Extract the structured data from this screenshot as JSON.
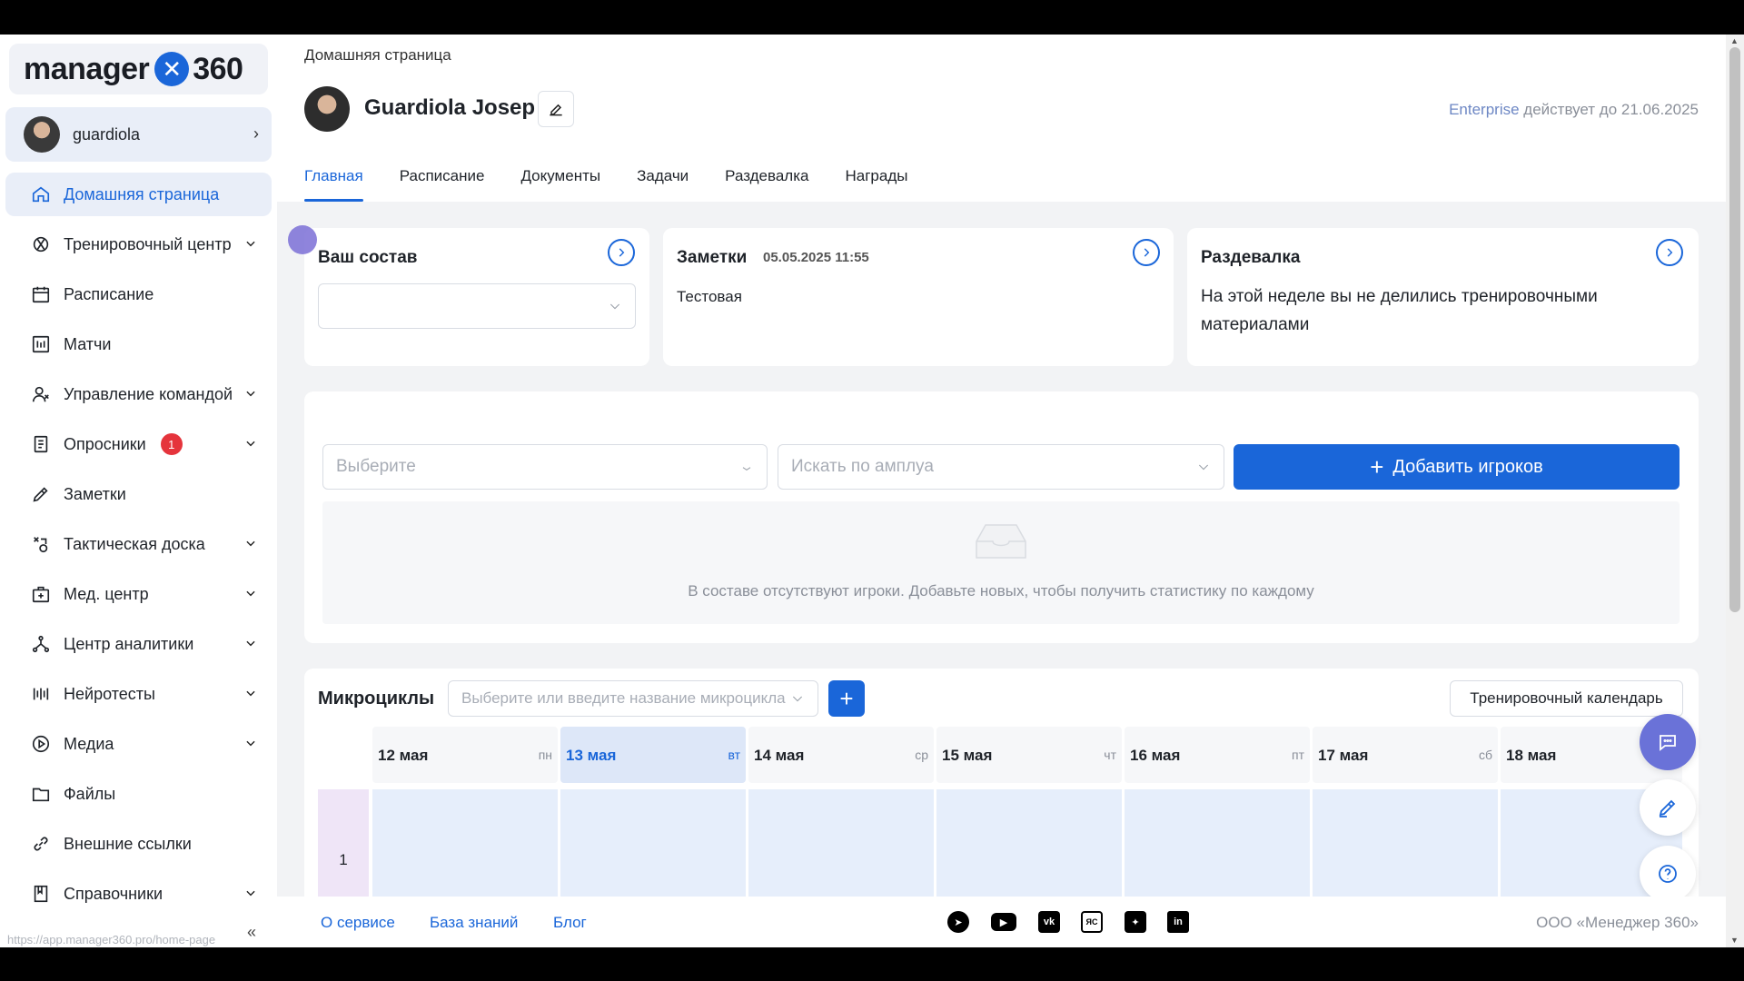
{
  "app": {
    "logo_text_left": "manager",
    "logo_text_right": "360"
  },
  "user": {
    "name": "guardiola"
  },
  "sidebar": {
    "items": [
      {
        "label": "Домашняя страница",
        "icon": "home-icon"
      },
      {
        "label": "Тренировочный центр",
        "icon": "dumbbell-icon"
      },
      {
        "label": "Расписание",
        "icon": "calendar-icon"
      },
      {
        "label": "Матчи",
        "icon": "board-icon"
      },
      {
        "label": "Управление командой",
        "icon": "team-icon"
      },
      {
        "label": "Опросники",
        "icon": "clipboard-icon",
        "badge": "1"
      },
      {
        "label": "Заметки",
        "icon": "pen-icon"
      },
      {
        "label": "Тактическая доска",
        "icon": "tactics-icon"
      },
      {
        "label": "Мед. центр",
        "icon": "medkit-icon"
      },
      {
        "label": "Центр аналитики",
        "icon": "analytics-icon"
      },
      {
        "label": "Нейротесты",
        "icon": "neuro-icon"
      },
      {
        "label": "Медиа",
        "icon": "play-icon"
      },
      {
        "label": "Файлы",
        "icon": "folder-icon"
      },
      {
        "label": "Внешние ссылки",
        "icon": "link-icon"
      },
      {
        "label": "Справочники",
        "icon": "book-icon"
      }
    ],
    "status_url": "https://app.manager360.pro/home-page"
  },
  "header": {
    "breadcrumb": "Домашняя страница",
    "profile_name": "Guardiola Josep",
    "plan_name": "Enterprise",
    "plan_suffix": " действует до 21.06.2025",
    "tabs": [
      "Главная",
      "Расписание",
      "Документы",
      "Задачи",
      "Раздевалка",
      "Награды"
    ]
  },
  "cards": {
    "roster_title": "Ваш состав",
    "notes_title": "Заметки",
    "notes_date": "05.05.2025 11:55",
    "notes_text": "Тестовая",
    "locker_title": "Раздевалка",
    "locker_text": "На этой неделе вы не делились тренировочными материалами"
  },
  "players": {
    "select_placeholder": "Выберите",
    "position_placeholder": "Искать по амплуа",
    "add_button": "Добавить игроков",
    "empty_text": "В составе отсутствуют игроки. Добавьте новых, чтобы получить статистику по каждому"
  },
  "micro": {
    "title": "Микроциклы",
    "select_placeholder": "Выберите или введите название микроцикла",
    "calendar_button": "Тренировочный календарь",
    "week_number": "1",
    "days": [
      {
        "date": "12 мая",
        "weekday": "пн"
      },
      {
        "date": "13 мая",
        "weekday": "вт"
      },
      {
        "date": "14 мая",
        "weekday": "ср"
      },
      {
        "date": "15 мая",
        "weekday": "чт"
      },
      {
        "date": "16 мая",
        "weekday": "пт"
      },
      {
        "date": "17 мая",
        "weekday": "сб"
      },
      {
        "date": "18 мая",
        "weekday": ""
      }
    ]
  },
  "footer": {
    "links": [
      "О сервисе",
      "База знаний",
      "Блог"
    ],
    "socials": [
      "telegram-icon",
      "youtube-icon",
      "vk-icon",
      "yandex-zen-icon",
      "dzen-icon",
      "linkedin-icon"
    ],
    "copyright": "ООО «Менеджер 360»"
  },
  "colors": {
    "accent": "#1a66d9",
    "badge": "#e5343c",
    "fab": "#6a72d8"
  }
}
